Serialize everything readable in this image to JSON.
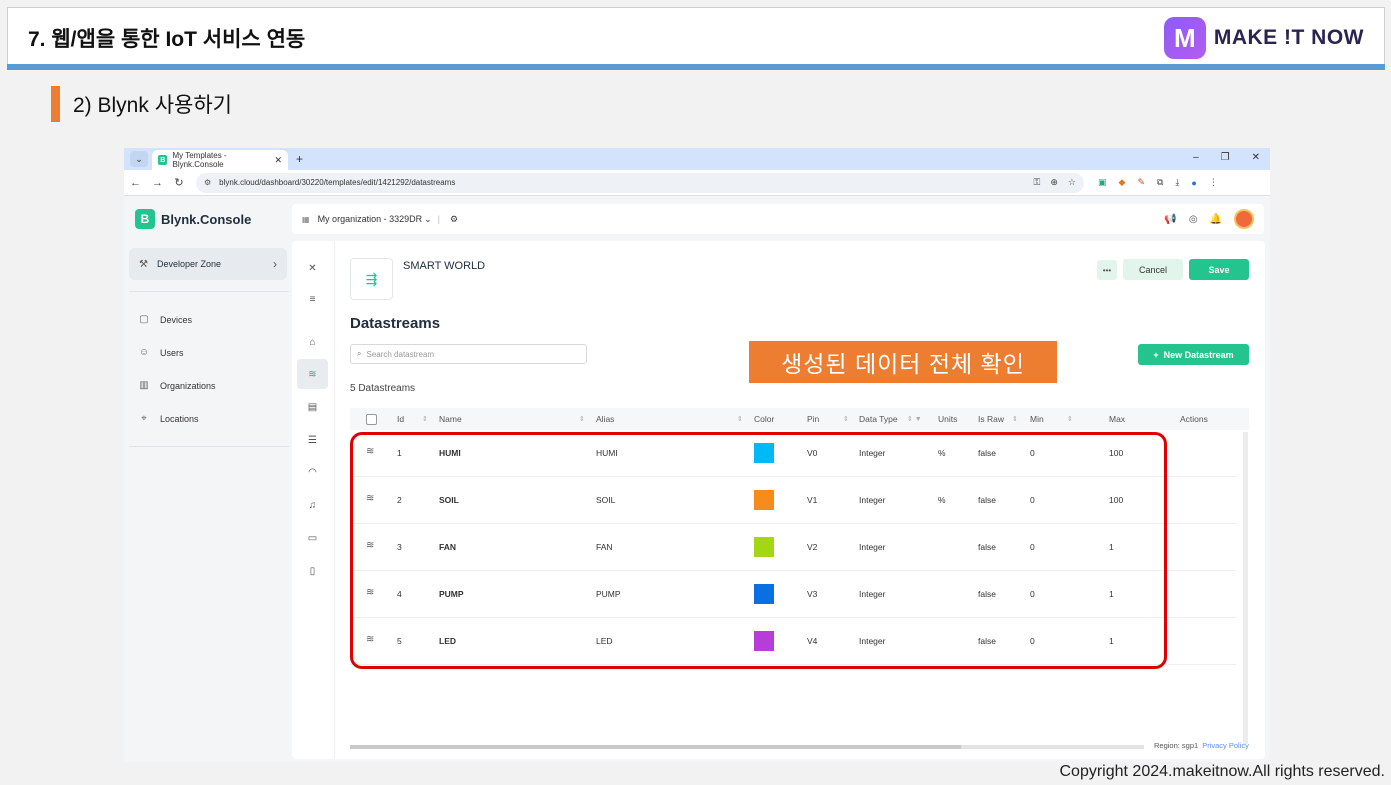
{
  "slide": {
    "title": "7. 웹/앱을 통한 IoT 서비스 연동",
    "logo_text": "MAKE !T NOW",
    "logo_mark": "M",
    "section": "2) Blynk 사용하기",
    "copyright": "Copyright 2024.makeitnow.All rights reserved.",
    "callout": "생성된 데이터 전체 확인",
    "colors": {
      "accent_orange": "#ed7d31",
      "header_blue": "#5b9bd5",
      "highlight_red": "#e00000"
    }
  },
  "browser": {
    "tab_title": "My Templates - Blynk.Console",
    "url": "blynk.cloud/dashboard/30220/templates/edit/1421292/datastreams",
    "icons": [
      "back-icon",
      "forward-icon",
      "reload-icon",
      "key-icon",
      "zoom-icon",
      "star-icon",
      "extension-icon",
      "download-icon",
      "profile-icon",
      "menu-icon"
    ]
  },
  "console": {
    "brand": "Blynk.Console",
    "organization": "My organization - 3329DR",
    "sidebar": {
      "developer_zone": "Developer Zone",
      "items": [
        {
          "label": "Devices",
          "icon": "devices-icon"
        },
        {
          "label": "Users",
          "icon": "users-icon"
        },
        {
          "label": "Organizations",
          "icon": "organizations-icon"
        },
        {
          "label": "Locations",
          "icon": "location-icon"
        }
      ]
    },
    "template": {
      "name": "SMART WORLD",
      "more_label": "•••",
      "cancel_label": "Cancel",
      "save_label": "Save"
    },
    "page_title": "Datastreams",
    "search_placeholder": "Search datastream",
    "new_button": "New Datastream",
    "count_label": "5 Datastreams",
    "columns": [
      "Id",
      "Name",
      "Alias",
      "Color",
      "Pin",
      "Data Type",
      "Units",
      "Is Raw",
      "Min",
      "Max",
      "Actions"
    ],
    "rows": [
      {
        "id": "1",
        "name": "HUMI",
        "alias": "HUMI",
        "color": "#00b8f5",
        "pin": "V0",
        "type": "Integer",
        "units": "%",
        "raw": "false",
        "min": "0",
        "max": "100"
      },
      {
        "id": "2",
        "name": "SOIL",
        "alias": "SOIL",
        "color": "#f78c1b",
        "pin": "V1",
        "type": "Integer",
        "units": "%",
        "raw": "false",
        "min": "0",
        "max": "100"
      },
      {
        "id": "3",
        "name": "FAN",
        "alias": "FAN",
        "color": "#a4d614",
        "pin": "V2",
        "type": "Integer",
        "units": "",
        "raw": "false",
        "min": "0",
        "max": "1"
      },
      {
        "id": "4",
        "name": "PUMP",
        "alias": "PUMP",
        "color": "#0a6fe0",
        "pin": "V3",
        "type": "Integer",
        "units": "",
        "raw": "false",
        "min": "0",
        "max": "1"
      },
      {
        "id": "5",
        "name": "LED",
        "alias": "LED",
        "color": "#b73dd8",
        "pin": "V4",
        "type": "Integer",
        "units": "",
        "raw": "false",
        "min": "0",
        "max": "1"
      }
    ],
    "region": "Region: sgp1",
    "privacy": "Privacy Policy"
  }
}
